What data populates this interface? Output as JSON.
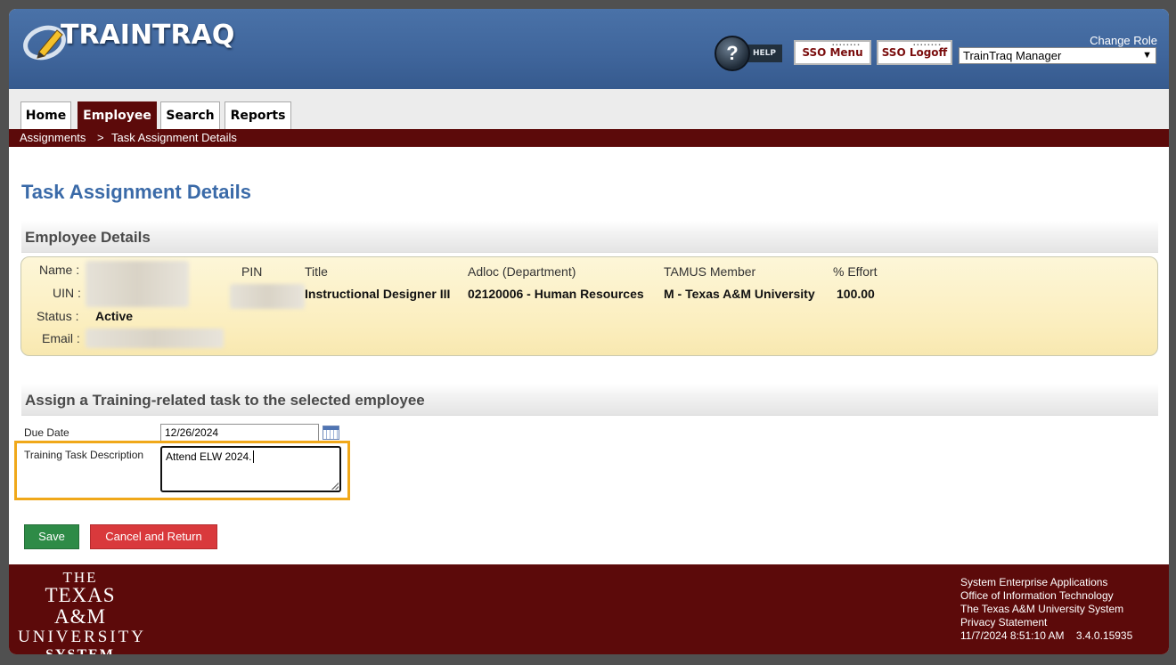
{
  "header": {
    "app_name": "TRAINTRAQ",
    "help_label": "HELP",
    "help_glyph": "?",
    "sso_menu_label": "SSO Menu",
    "sso_logoff_label": "SSO Logoff",
    "change_role_label": "Change Role",
    "role_selected": "TrainTraq Manager",
    "colors": {
      "header_blue": "#4a72a8",
      "maroon": "#5c0a0a"
    }
  },
  "tabs": [
    {
      "label": "Home",
      "active": false
    },
    {
      "label": "Employee",
      "active": true
    },
    {
      "label": "Search",
      "active": false
    },
    {
      "label": "Reports",
      "active": false
    }
  ],
  "breadcrumb": {
    "items": [
      "Assignments",
      "Task Assignment Details"
    ],
    "separator": ">"
  },
  "page": {
    "title": "Task Assignment Details"
  },
  "employee_details": {
    "heading": "Employee Details",
    "name_label": "Name :",
    "uin_label": "UIN :",
    "status_label": "Status :",
    "status_value": "Active",
    "email_label": "Email :",
    "columns": {
      "pin": "PIN",
      "title": "Title",
      "adloc": "Adloc (Department)",
      "tamus": "TAMUS Member",
      "effort": "% Effort"
    },
    "row": {
      "title": "Instructional Designer III",
      "adloc": "02120006 - Human Resources",
      "tamus": "M - Texas A&M University",
      "effort": "100.00"
    }
  },
  "assign": {
    "heading": "Assign a Training-related task to the selected employee",
    "due_date_label": "Due Date",
    "due_date_value": "12/26/2024",
    "desc_label": "Training Task Description",
    "desc_value": "Attend ELW 2024."
  },
  "buttons": {
    "save": "Save",
    "cancel": "Cancel and Return"
  },
  "footer": {
    "logo": {
      "line1": "THE",
      "line2": "TEXAS A&M",
      "line3": "UNIVERSITY",
      "line4": "SYSTEM"
    },
    "links": [
      "System Enterprise Applications",
      "Office of Information Technology",
      "The Texas A&M University System",
      "Privacy Statement"
    ],
    "timestamp": "11/7/2024 8:51:10 AM",
    "version": "3.4.0.15935"
  }
}
